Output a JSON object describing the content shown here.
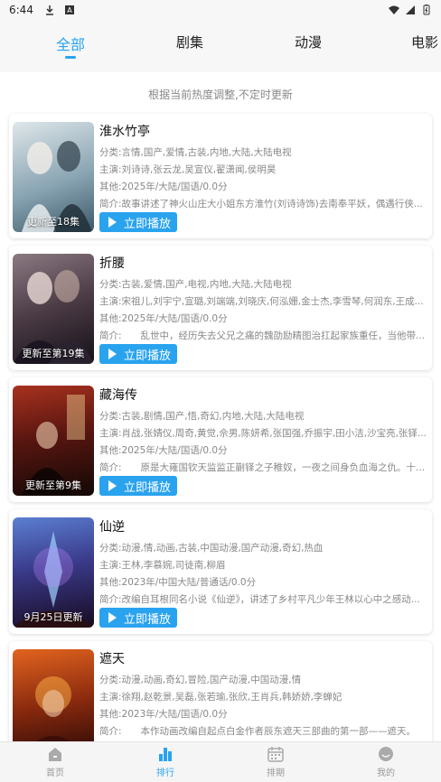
{
  "status_bar": {
    "time": "6:44",
    "icons": [
      "download-icon",
      "notification-a-icon",
      "wifi-icon",
      "signal-icon",
      "battery-icon"
    ]
  },
  "tabs": [
    {
      "label": "全部",
      "active": true
    },
    {
      "label": "剧集",
      "active": false
    },
    {
      "label": "动漫",
      "active": false
    },
    {
      "label": "电影",
      "active": false
    }
  ],
  "accent_color": "#2aa3ee",
  "notice": "根据当前热度调整,不定时更新",
  "play_label": "立即播放",
  "items": [
    {
      "title": "淮水竹亭",
      "category": "分类:言情,国产,爱情,古装,内地,大陆,大陆电视",
      "cast": "主演:刘诗诗,张云龙,吴宣仪,翟潇闻,侯明昊",
      "other": "其他:2025年/大陆/国语/0.0分",
      "intro": "简介:故事讲述了神火山庄大小姐东方淮竹(刘诗诗饰)去南奉平妖，偶遇行侠...",
      "episode": "更新至18集",
      "poster_colors": [
        "#c9d6dd",
        "#4b6b7a"
      ]
    },
    {
      "title": "折腰",
      "category": "分类:古装,爱情,国产,电视,内地,大陆,大陆电视",
      "cast": "主演:宋祖儿,刘宇宁,宣璐,刘端端,刘晓庆,何泓姗,金士杰,李雪琴,何润东,王成...",
      "other": "其他:2025年/大陆/国语/0.0分",
      "intro": "简介:　　乱世中，经历失去父兄之痛的魏劭励精图治扛起家族重任，当他带...",
      "episode": "更新至第19集",
      "poster_colors": [
        "#5a4a52",
        "#1e1a24"
      ]
    },
    {
      "title": "藏海传",
      "category": "分类:古装,剧情,国产,悟,奇幻,内地,大陆,大陆电视",
      "cast": "主演:肖战,张婧仪,周奇,黄觉,佘男,陈妍希,张国强,乔振宇,田小洁,沙宝亮,张铎...",
      "other": "其他:2025年/大陆/国语/0.0分",
      "intro": "简介:　　原是大雍国钦天监监正蒯铎之子稚奴，一夜之间身负血海之仇。十...",
      "episode": "更新至第9集",
      "poster_colors": [
        "#6b1a14",
        "#1a0c08"
      ]
    },
    {
      "title": "仙逆",
      "category": "分类:动漫,情,动画,古装,中国动漫,国产动漫,奇幻,热血",
      "cast": "主演:王林,李慕婉,司徒南,柳眉",
      "other": "其他:2023年/中国大陆/普通话/0.0分",
      "intro": "简介:改编自耳根同名小说《仙逆》，讲述了乡村平凡少年王林以心中之感动...",
      "episode": "9月25日更新",
      "poster_colors": [
        "#3a4f8a",
        "#1a1030"
      ]
    },
    {
      "title": "遮天",
      "category": "分类:动漫,动画,奇幻,冒险,国产动漫,中国动漫,情",
      "cast": "主演:徐翔,赵乾景,吴磊,张若瑜,张欣,王肖兵,韩娇娇,李蝉妃",
      "other": "其他:2023年/大陆/国语/0.0分",
      "intro": "简介:　　本作动画改编自起点白金作者辰东遮天三部曲的第一部——遮天。",
      "episode": "",
      "poster_colors": [
        "#d0471a",
        "#2a0a06"
      ]
    }
  ],
  "bottom_nav": [
    {
      "label": "首页",
      "icon": "home-icon",
      "active": false
    },
    {
      "label": "排行",
      "icon": "ranking-icon",
      "active": true
    },
    {
      "label": "排期",
      "icon": "calendar-icon",
      "active": false
    },
    {
      "label": "我的",
      "icon": "profile-icon",
      "active": false
    }
  ]
}
